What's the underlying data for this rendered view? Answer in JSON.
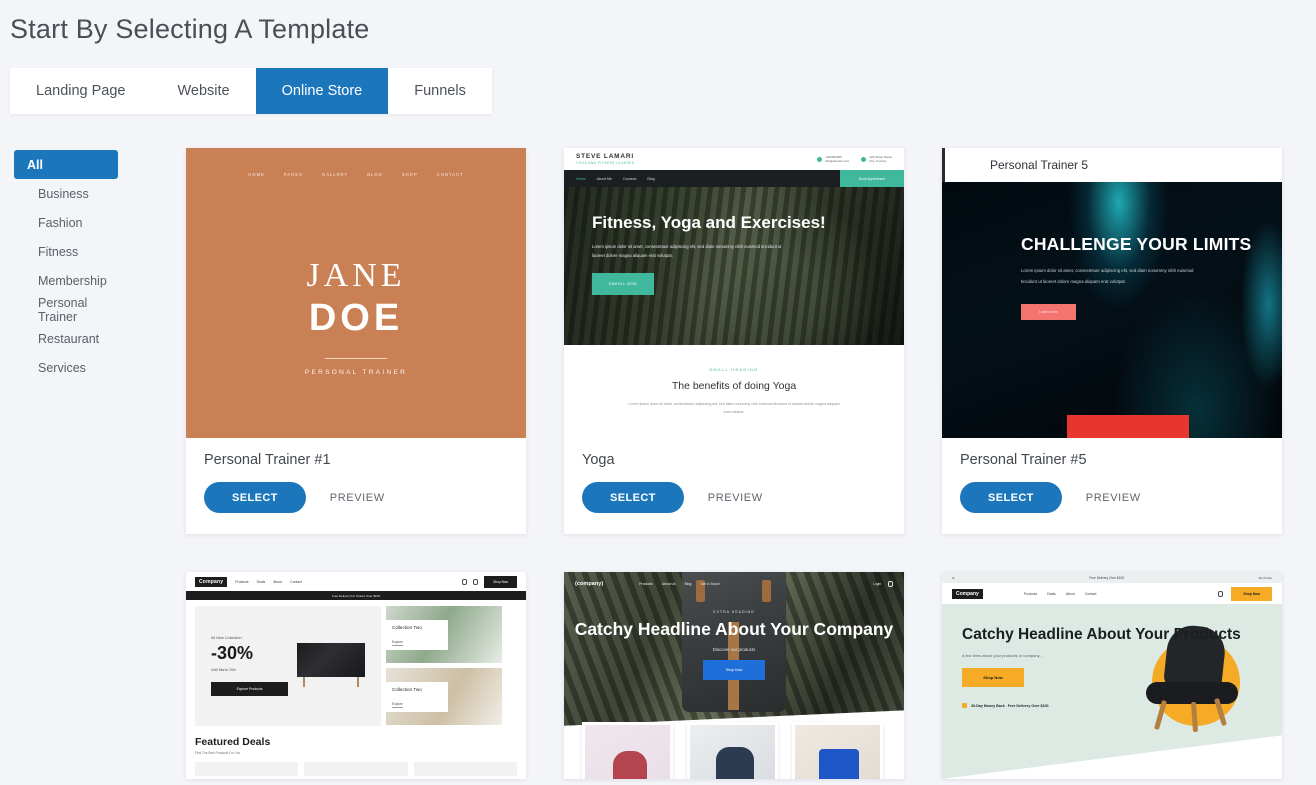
{
  "header": {
    "title": "Start By Selecting A Template"
  },
  "tabs": [
    {
      "label": "Landing Page",
      "active": false
    },
    {
      "label": "Website",
      "active": false
    },
    {
      "label": "Online Store",
      "active": true
    },
    {
      "label": "Funnels",
      "active": false
    }
  ],
  "categories": [
    {
      "label": "All",
      "active": true
    },
    {
      "label": "Business",
      "active": false
    },
    {
      "label": "Fashion",
      "active": false
    },
    {
      "label": "Fitness",
      "active": false
    },
    {
      "label": "Membership",
      "active": false
    },
    {
      "label": "Personal Trainer",
      "active": false
    },
    {
      "label": "Restaurant",
      "active": false
    },
    {
      "label": "Services",
      "active": false
    }
  ],
  "colors": {
    "accent_blue": "#1b76bc",
    "page_background": "#f4f5f9",
    "card_background": "#ffffff",
    "terracotta": "#ca8055",
    "teal": "#3fb89c",
    "coral": "#f4756f",
    "red": "#e8352d",
    "amber": "#f5ab25"
  },
  "buttons": {
    "select": "SELECT",
    "preview": "PREVIEW"
  },
  "templates": [
    {
      "name": "Personal Trainer #1",
      "select_label": "SELECT",
      "preview_label": "PREVIEW",
      "preview_content": {
        "nav": [
          "HOME",
          "PAGES",
          "GALLERY",
          "BLOG",
          "SHOP",
          "CONTACT"
        ],
        "first_name": "JANE",
        "last_name": "DOE",
        "subtitle": "PERSONAL TRAINER"
      }
    },
    {
      "name": "Yoga",
      "select_label": "SELECT",
      "preview_label": "PREVIEW",
      "preview_content": {
        "brand": "STEVE LAMARI",
        "tagline": "YOGA AND FITNESS CLASSES",
        "phone": "+000000000",
        "email": "info@domain.com",
        "address_line1": "123 Street Name",
        "address_line2": "City, Country",
        "nav": [
          "Home",
          "About Me",
          "Courses",
          "Blog"
        ],
        "cta": "Book Appointment",
        "headline": "Fitness, Yoga and Exercises!",
        "body": "Lorem ipsum dolor sit amet, consectetuer adipiscing elit, sed diam nonummy nibh euismod tincidunt ut laoreet dolore magna aliquam erat volutpat.",
        "hero_button": "ENROLL NOW",
        "small_heading": "SMALL HEADING",
        "section_title": "The benefits of doing Yoga",
        "section_body": "Lorem ipsum dolor sit amet, consectetuer adipiscing elit, sed diam nonummy nibh euismod tincidunt ut laoreet dolore magna aliquam erat volutpat."
      }
    },
    {
      "name": "Personal Trainer #5",
      "select_label": "SELECT",
      "preview_label": "PREVIEW",
      "preview_content": {
        "bar_title": "Personal Trainer 5",
        "headline": "CHALLENGE YOUR LIMITS",
        "body": "Lorem ipsum dolor sit amet, consectetuer adipiscing elit, sed diam nonummy nibh euismod tincidunt ut laoreet dolore magna aliquam erat volutpat.",
        "button": "Learn more"
      }
    },
    {
      "name": "",
      "preview_content": {
        "logo": "Company",
        "nav": [
          "Products",
          "Deals",
          "About",
          "Contact"
        ],
        "shop_button": "Shop Now",
        "strip": "Free Delivery For Orders Over $100",
        "promo_label": "All New Collection",
        "promo_discount": "-30%",
        "promo_until": "Until March 20th",
        "promo_button": "Explore Products",
        "collection_one_title": "Collection Two",
        "collection_one_link": "Explore",
        "collection_two_title": "Collection Two",
        "collection_two_link": "Explore",
        "featured_title": "Featured Deals",
        "featured_sub": "Find The Best Products For You"
      }
    },
    {
      "name": "",
      "preview_content": {
        "logo": "(company)",
        "nav": [
          "Products",
          "About Us",
          "Blog",
          "Get In Touch"
        ],
        "login": "Login",
        "extra_heading": "EXTRA HEADING",
        "headline": "Catchy Headline About Your Company",
        "sub": "Discover our products",
        "button": "Shop Now"
      }
    },
    {
      "name": "",
      "preview_content": {
        "top_center": "Free Delivery Over $100",
        "top_right": "My Profile",
        "logo": "Company",
        "nav": [
          "Products",
          "Deals",
          "About",
          "Contact"
        ],
        "shop_button": "Shop Now",
        "headline": "Catchy Headline About Your Products",
        "sub": "A few lines about your products or company...",
        "button": "Shop Now",
        "note": "30-Day Money Back . Free Delivery Over $100"
      }
    }
  ]
}
